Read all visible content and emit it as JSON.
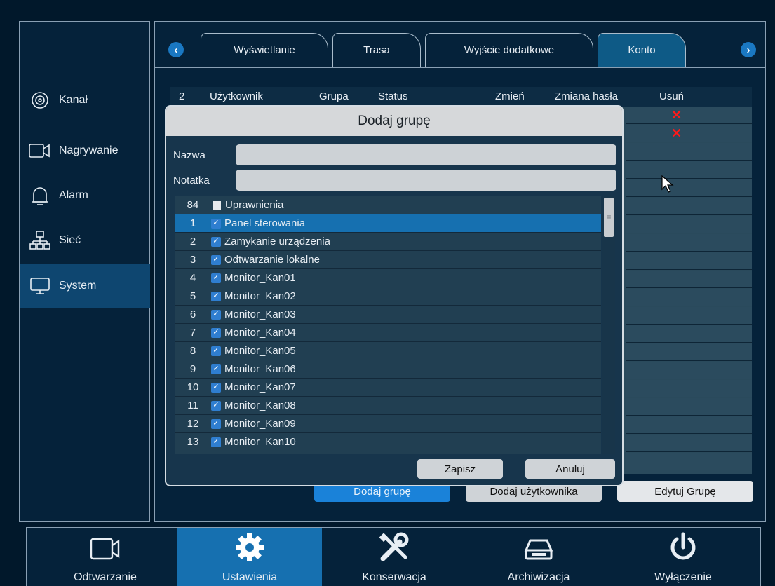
{
  "sidebar": {
    "items": [
      {
        "label": "Kanał",
        "icon": "camera-lens-icon"
      },
      {
        "label": "Nagrywanie",
        "icon": "video-camera-icon"
      },
      {
        "label": "Alarm",
        "icon": "bell-icon"
      },
      {
        "label": "Sieć",
        "icon": "network-icon"
      },
      {
        "label": "System",
        "icon": "monitor-icon",
        "active": true
      }
    ]
  },
  "tabs": {
    "prev": "‹",
    "next": "›",
    "items": [
      "Wyświetlanie",
      "Trasa",
      "Wyjście dodatkowe",
      "Konto"
    ],
    "active": "Konto"
  },
  "user_table": {
    "count": "2",
    "headers": [
      "Użytkownik",
      "Grupa",
      "Status",
      "Zmień",
      "Zmiana hasła",
      "Usuń"
    ],
    "delete_mark": "✕"
  },
  "actions": {
    "add_group": "Dodaj grupę",
    "add_user": "Dodaj użytkownika",
    "edit_group": "Edytuj Grupę"
  },
  "dialog": {
    "title": "Dodaj grupę",
    "name_label": "Nazwa",
    "name_value": "",
    "note_label": "Notatka",
    "note_value": "",
    "perm_count": "84",
    "perm_header": "Uprawnienia",
    "permissions": [
      {
        "num": "1",
        "label": "Panel sterowania",
        "selected": true
      },
      {
        "num": "2",
        "label": "Zamykanie urządzenia"
      },
      {
        "num": "3",
        "label": "Odtwarzanie lokalne"
      },
      {
        "num": "4",
        "label": "Monitor_Kan01"
      },
      {
        "num": "5",
        "label": "Monitor_Kan02"
      },
      {
        "num": "6",
        "label": "Monitor_Kan03"
      },
      {
        "num": "7",
        "label": "Monitor_Kan04"
      },
      {
        "num": "8",
        "label": "Monitor_Kan05"
      },
      {
        "num": "9",
        "label": "Monitor_Kan06"
      },
      {
        "num": "10",
        "label": "Monitor_Kan07"
      },
      {
        "num": "11",
        "label": "Monitor_Kan08"
      },
      {
        "num": "12",
        "label": "Monitor_Kan09"
      },
      {
        "num": "13",
        "label": "Monitor_Kan10"
      }
    ],
    "save": "Zapisz",
    "cancel": "Anuluj"
  },
  "bottombar": {
    "items": [
      {
        "label": "Odtwarzanie",
        "icon": "video-camera-icon"
      },
      {
        "label": "Ustawienia",
        "icon": "gear-icon",
        "active": true
      },
      {
        "label": "Konserwacja",
        "icon": "tools-icon"
      },
      {
        "label": "Archiwizacja",
        "icon": "drive-icon"
      },
      {
        "label": "Wyłączenie",
        "icon": "power-icon"
      }
    ]
  },
  "colors": {
    "background": "#01182b",
    "accent": "#1670b0",
    "delete": "#ff1a1a"
  }
}
